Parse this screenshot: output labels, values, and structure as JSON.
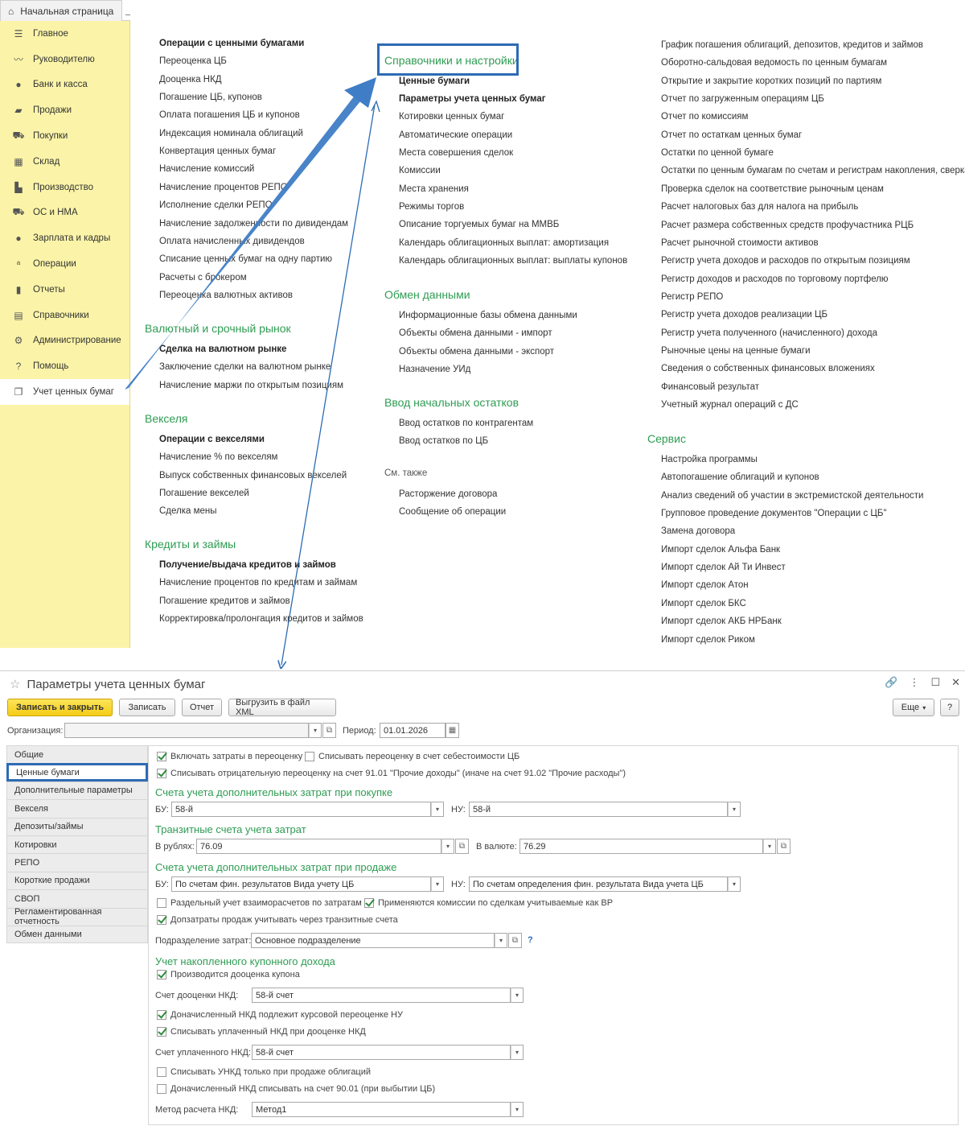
{
  "top": {
    "home_tab": "Начальная страница",
    "sidebar": [
      {
        "label": "Главное",
        "icon": "menu-icon"
      },
      {
        "label": "Руководителю",
        "icon": "chart-line-icon"
      },
      {
        "label": "Банк и касса",
        "icon": "coin-icon"
      },
      {
        "label": "Продажи",
        "icon": "bag-icon"
      },
      {
        "label": "Покупки",
        "icon": "cart-icon"
      },
      {
        "label": "Склад",
        "icon": "grid-icon"
      },
      {
        "label": "Производство",
        "icon": "factory-icon"
      },
      {
        "label": "ОС и НМА",
        "icon": "truck-icon"
      },
      {
        "label": "Зарплата и кадры",
        "icon": "person-icon"
      },
      {
        "label": "Операции",
        "icon": "operations-icon"
      },
      {
        "label": "Отчеты",
        "icon": "bar-chart-icon"
      },
      {
        "label": "Справочники",
        "icon": "book-icon"
      },
      {
        "label": "Администрирование",
        "icon": "gear-icon"
      },
      {
        "label": "Помощь",
        "icon": "question-icon"
      },
      {
        "label": "Учет ценных бумаг",
        "icon": "documents-icon"
      }
    ],
    "col1": {
      "group1_header": "Операции с ценными бумагами",
      "group1": [
        "Переоценка ЦБ",
        "Дооценка НКД",
        "Погашение ЦБ, купонов",
        "Оплата погашения ЦБ и купонов",
        "Индексация номинала облигаций",
        "Конвертация ценных бумаг",
        "Начисление комиссий",
        "Начисление процентов РЕПО",
        "Исполнение сделки РЕПО",
        "Начисление задолженности по дивидендам",
        "Оплата начисленных дивидендов",
        "Списание ценных бумаг на одну партию",
        "Расчеты с брокером",
        "Переоценка валютных активов"
      ],
      "sec2": "Валютный и срочный рынок",
      "group2_header": "Сделка на валютном рынке",
      "group2": [
        "Заключение сделки на валютном рынке",
        "Начисление маржи по открытым позициям"
      ],
      "sec3": "Векселя",
      "group3_header": "Операции с векселями",
      "group3": [
        "Начисление % по векселям",
        "Выпуск собственных финансовых векселей",
        "Погашение векселей",
        "Сделка мены"
      ],
      "sec4": "Кредиты и займы",
      "group4_header": "Получение/выдача кредитов и займов",
      "group4": [
        "Начисление процентов по кредитам и займам",
        "Погашение кредитов и займов",
        "Корректировка/пролонгация кредитов и займов"
      ]
    },
    "col2": {
      "sec1": "Справочники и настройки",
      "bold1": "Ценные бумаги",
      "bold2": "Параметры учета ценных бумаг",
      "group1": [
        "Котировки ценных бумаг",
        "Автоматические операции",
        "Места совершения сделок",
        "Комиссии",
        "Места хранения",
        "Режимы торгов",
        "Описание торгуемых бумаг на ММВБ",
        "Календарь облигационных выплат: амортизация",
        "Календарь облигационных выплат: выплаты купонов"
      ],
      "sec2": "Обмен данными",
      "group2": [
        "Информационные базы обмена данными",
        "Объекты обмена данными - импорт",
        "Объекты обмена данными - экспорт",
        "Назначение УИд"
      ],
      "sec3": "Ввод начальных остатков",
      "group3": [
        "Ввод остатков по контрагентам",
        "Ввод остатков по ЦБ"
      ],
      "see_also": "См. также",
      "group4": [
        "Расторжение договора",
        "Сообщение об операции"
      ]
    },
    "col3": {
      "group1": [
        "График погашения облигаций, депозитов, кредитов и займов",
        "Оборотно-сальдовая ведомость по ценным бумагам",
        "Открытие и закрытие коротких позиций по партиям",
        "Отчет по загруженным операциям ЦБ",
        "Отчет по комиссиям",
        "Отчет по остаткам ценных бумаг",
        "Остатки по ценной бумаге",
        "Остатки по ценным бумагам по счетам и регистрам накопления, сверка",
        "Проверка сделок на соответствие рыночным ценам",
        "Расчет налоговых баз для налога на прибыль",
        "Расчет размера собственных средств профучастника РЦБ",
        "Расчет рыночной стоимости активов",
        "Регистр учета доходов и расходов по открытым позициям",
        "Регистр доходов и расходов по торговому портфелю",
        "Регистр РЕПО",
        "Регистр учета доходов реализации ЦБ",
        "Регистр учета полученного (начисленного) дохода",
        "Рыночные цены на ценные бумаги",
        "Сведения о собственных финансовых вложениях",
        "Финансовый результат",
        "Учетный журнал операций с ДС"
      ],
      "sec2": "Сервис",
      "group2": [
        "Настройка программы",
        "Автопогашение облигаций и купонов",
        "Анализ сведений об участии в экстремистской деятельности",
        "Групповое проведение документов \"Операции с ЦБ\"",
        "Замена договора",
        "Импорт сделок Альфа Банк",
        "Импорт сделок Ай Ти Инвест",
        "Импорт сделок Атон",
        "Импорт сделок БКС",
        "Импорт сделок АКБ НРБанк",
        "Импорт сделок Риком"
      ]
    }
  },
  "form": {
    "title": "Параметры учета ценных бумаг",
    "buttons": {
      "save_close": "Записать и закрыть",
      "save": "Записать",
      "report": "Отчет",
      "export_xml": "Выгрузить в файл XML",
      "more": "Еще",
      "help": "?"
    },
    "org_label": "Организация:",
    "org_value": "",
    "period_label": "Период:",
    "period_value": "01.01.2026",
    "nav": [
      "Общие",
      "Ценные бумаги",
      "Дополнительные параметры",
      "Векселя",
      "Депозиты/займы",
      "Котировки",
      "РЕПО",
      "Короткие продажи",
      "СВОП",
      "Регламентированная отчетность",
      "Обмен данными"
    ],
    "panel": {
      "chk_include_costs": {
        "label": "Включать затраты в переоценку",
        "checked": true
      },
      "chk_write_off_cost": {
        "label": "Списывать переоценку в счет себестоимости ЦБ",
        "checked": false
      },
      "chk_negative": {
        "label": "Списывать отрицательную переоценку на счет 91.01 \"Прочие доходы\" (иначе на счет 91.02 \"Прочие расходы\")",
        "checked": true
      },
      "sec_buy": "Счета учета дополнительных затрат при покупке",
      "bu_label": "БУ:",
      "nu_label": "НУ:",
      "buy_bu": "58-й",
      "buy_nu": "58-й",
      "sec_transit": "Транзитные счета учета затрат",
      "rub_label": "В рублях:",
      "rub_value": "76.09",
      "cur_label": "В валюте:",
      "cur_value": "76.29",
      "sec_sell": "Счета учета дополнительных затрат при продаже",
      "sell_bu": "По счетам фин. результатов Вида учету ЦБ",
      "sell_nu": "По счетам определения фин. результата Вида учета ЦБ",
      "chk_separate": {
        "label": "Раздельный учет взаиморасчетов по затратам",
        "checked": false
      },
      "chk_commissions": {
        "label": "Применяются комиссии по сделкам учитываемые как ВР",
        "checked": true
      },
      "chk_transit": {
        "label": "Допзатраты продаж учитывать через транзитные счета",
        "checked": true
      },
      "dept_label": "Подразделение затрат:",
      "dept_value": "Основное подразделение",
      "help": "?",
      "sec_coupon": "Учет накопленного купонного дохода",
      "chk_revalue_coupon": {
        "label": "Производится дооценка купона",
        "checked": true
      },
      "nkd_account_label": "Счет дооценки НКД:",
      "nkd_account_value": "58-й счет",
      "chk_accrued_fx": {
        "label": "Доначисленный НКД подлежит курсовой переоценке НУ",
        "checked": true
      },
      "chk_paid_nkd": {
        "label": "Списывать уплаченный НКД при дооценке НКД",
        "checked": true
      },
      "paid_nkd_label": "Счет уплаченного НКД:",
      "paid_nkd_value": "58-й счет",
      "chk_unkd": {
        "label": "Списывать УНКД только при продаже облигаций",
        "checked": false
      },
      "chk_accrued_9001": {
        "label": "Доначисленный НКД списывать на счет 90.01 (при выбытии ЦБ)",
        "checked": false
      },
      "method_label": "Метод расчета НКД:",
      "method_value": "Метод1"
    }
  },
  "colors": {
    "accent_green": "#2f9c53",
    "highlight_blue": "#2d6bb4",
    "sidebar_yellow": "#fbf4a8",
    "button_yellow": "#f4cc15"
  }
}
